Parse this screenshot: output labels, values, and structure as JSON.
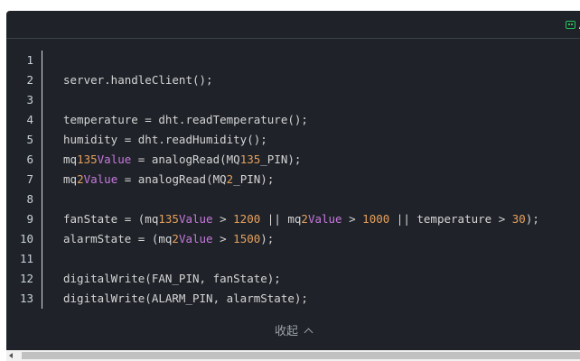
{
  "toolbar": {
    "ai_label": "A"
  },
  "code": {
    "lines": [
      {
        "n": "1",
        "parts": []
      },
      {
        "n": "2",
        "parts": [
          {
            "t": "server.handleClient();",
            "c": ""
          }
        ]
      },
      {
        "n": "3",
        "parts": []
      },
      {
        "n": "4",
        "parts": [
          {
            "t": "temperature = dht.readTemperature();",
            "c": ""
          }
        ]
      },
      {
        "n": "5",
        "parts": [
          {
            "t": "humidity = dht.readHumidity();",
            "c": ""
          }
        ]
      },
      {
        "n": "6",
        "parts": [
          {
            "t": "mq",
            "c": ""
          },
          {
            "t": "135",
            "c": "num"
          },
          {
            "t": "Value",
            "c": "kw"
          },
          {
            "t": " = analogRead(MQ",
            "c": ""
          },
          {
            "t": "135",
            "c": "num"
          },
          {
            "t": "_PIN);",
            "c": ""
          }
        ]
      },
      {
        "n": "7",
        "parts": [
          {
            "t": "mq",
            "c": ""
          },
          {
            "t": "2",
            "c": "num"
          },
          {
            "t": "Value",
            "c": "kw"
          },
          {
            "t": " = analogRead(MQ",
            "c": ""
          },
          {
            "t": "2",
            "c": "num"
          },
          {
            "t": "_PIN);",
            "c": ""
          }
        ]
      },
      {
        "n": "8",
        "parts": []
      },
      {
        "n": "9",
        "parts": [
          {
            "t": "fanState = (mq",
            "c": ""
          },
          {
            "t": "135",
            "c": "num"
          },
          {
            "t": "Value",
            "c": "kw"
          },
          {
            "t": " > ",
            "c": ""
          },
          {
            "t": "1200",
            "c": "num"
          },
          {
            "t": " || mq",
            "c": ""
          },
          {
            "t": "2",
            "c": "num"
          },
          {
            "t": "Value",
            "c": "kw"
          },
          {
            "t": " > ",
            "c": ""
          },
          {
            "t": "1000",
            "c": "num"
          },
          {
            "t": " || temperature > ",
            "c": ""
          },
          {
            "t": "30",
            "c": "num"
          },
          {
            "t": ");",
            "c": ""
          }
        ]
      },
      {
        "n": "10",
        "parts": [
          {
            "t": "alarmState = (mq",
            "c": ""
          },
          {
            "t": "2",
            "c": "num"
          },
          {
            "t": "Value",
            "c": "kw"
          },
          {
            "t": " > ",
            "c": ""
          },
          {
            "t": "1500",
            "c": "num"
          },
          {
            "t": ");",
            "c": ""
          }
        ]
      },
      {
        "n": "11",
        "parts": []
      },
      {
        "n": "12",
        "parts": [
          {
            "t": "digitalWrite(FAN_PIN, fanState);",
            "c": ""
          }
        ]
      },
      {
        "n": "13",
        "parts": [
          {
            "t": "digitalWrite(ALARM_PIN, alarmState);",
            "c": ""
          }
        ]
      }
    ]
  },
  "footer": {
    "collapse_label": "收起"
  },
  "colors": {
    "background": "#1f2329",
    "number": "#e6a05c",
    "keyword": "#c678dd",
    "ai_icon": "#22c55e"
  },
  "icons": {
    "ai": "ai-chat-icon",
    "collapse": "chevron-up-icon",
    "scroll_left": "arrow-left-icon"
  }
}
